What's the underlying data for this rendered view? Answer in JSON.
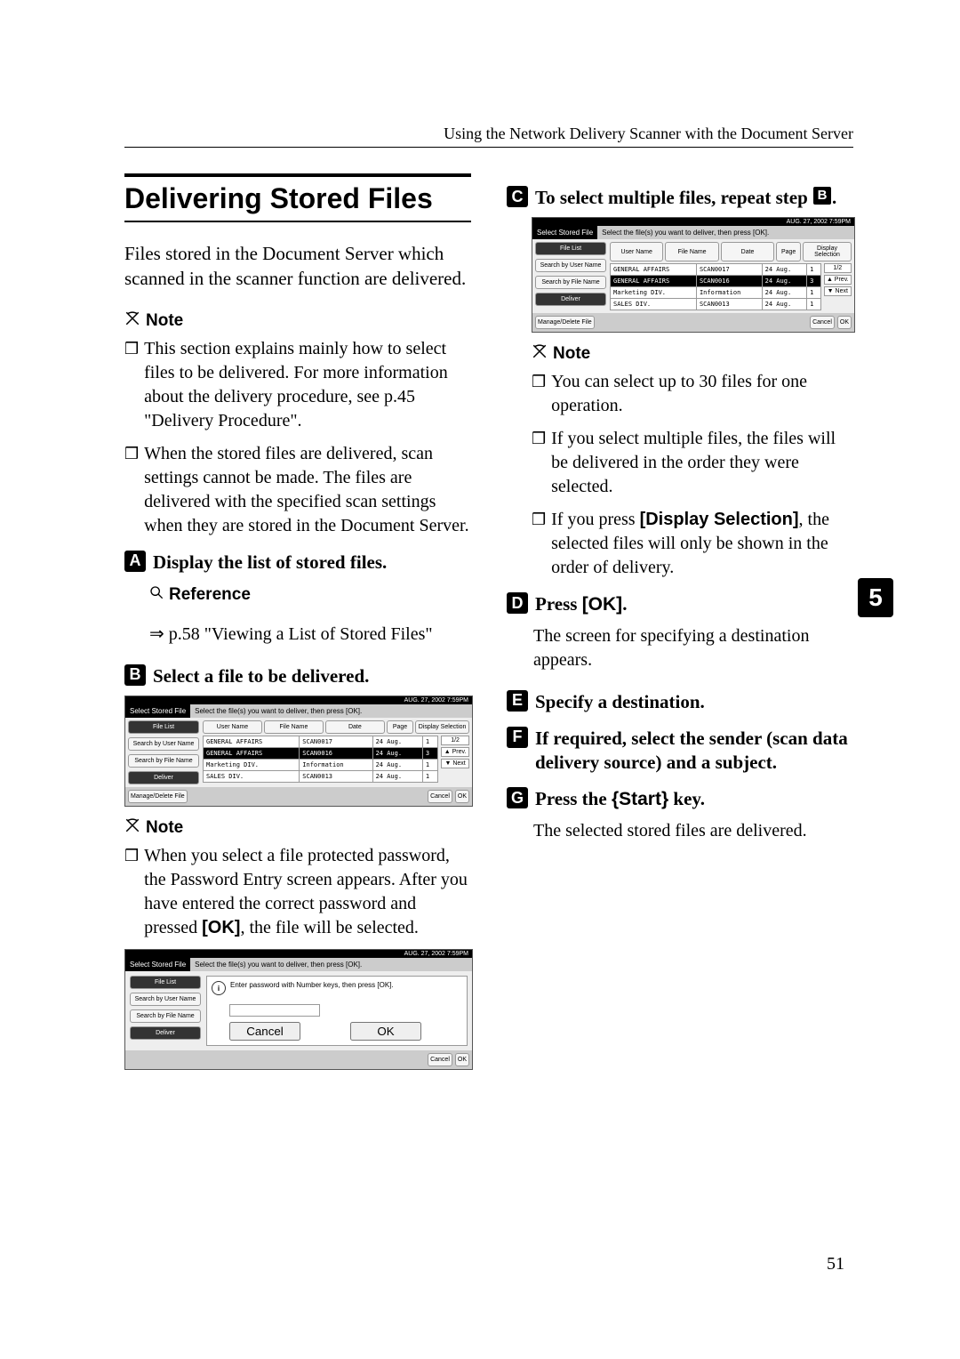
{
  "header": "Using the Network Delivery Scanner with the Document Server",
  "page_number": "51",
  "side_tab": "5",
  "h1": "Delivering Stored Files",
  "intro": "Files stored in the Document Server which scanned in the scanner function are delivered.",
  "labels": {
    "note": "Note",
    "reference": "Reference"
  },
  "col1": {
    "note1": [
      "This section explains mainly how to select files to be delivered. For more information about the delivery procedure, see p.45 \"Delivery Procedure\".",
      "When the stored files are delivered, scan settings cannot be made. The files are delivered with the specified scan settings when they are stored in the Document Server."
    ],
    "step1": "Display the list of stored files.",
    "ref1": "p.58 \"Viewing a List of Stored Files\"",
    "step2": "Select a file to be delivered.",
    "note2": [
      "When you select a file protected password, the Password Entry screen appears. After you have entered the correct password and pressed [OK], the file will be selected."
    ]
  },
  "col2": {
    "step3_a": "To select multiple files, repeat step ",
    "step3_b": ".",
    "note3": [
      "You can select up to 30 files for one operation.",
      "If you select multiple files, the files will be delivered in the order they were selected.",
      "If you press [Display Selection], the selected files will only be shown in the order of delivery."
    ],
    "step4": "Press [OK].",
    "step4_body": "The screen for specifying a destination appears.",
    "step5": "Specify a destination.",
    "step6": "If required, select the sender (scan data delivery source) and a subject.",
    "step7_a": "Press the ",
    "step7_key": "{Start}",
    "step7_b": " key.",
    "step7_body": "The selected stored files are delivered."
  },
  "screenshots": {
    "timestamp": "AUG. 27, 2002  7:59PM",
    "select_title": "Select Stored File",
    "select_instr": "Select the file(s) you want to deliver, then press [OK].",
    "leftbtns": [
      "File List",
      "Search by User Name",
      "Search by File Name",
      "Deliver"
    ],
    "headers": [
      "User Name",
      "File Name",
      "Date",
      "Page",
      "Display Selection"
    ],
    "rows": [
      {
        "user": "GENERAL AFFAIRS",
        "file": "SCAN0017",
        "date": "24 Aug.",
        "page": "1"
      },
      {
        "user": "GENERAL AFFAIRS",
        "file": "SCAN0016",
        "date": "24 Aug.",
        "page": "3"
      },
      {
        "user": "Marketing DIV.",
        "file": "Information",
        "date": "24 Aug.",
        "page": "1"
      },
      {
        "user": "SALES DIV.",
        "file": "SCAN0013",
        "date": "24 Aug.",
        "page": "1"
      }
    ],
    "rows2": [
      {
        "user": "GENERAL AFFAIRS",
        "file": "SCAN0017",
        "date": "24 Aug.",
        "page": "1"
      },
      {
        "user": "GENERAL AFFAIRS",
        "file": "SCAN0016",
        "date": "24 Aug.",
        "page": "3"
      },
      {
        "user": "Marketing DIV.",
        "file": "Information",
        "date": "24 Aug.",
        "page": "1"
      },
      {
        "user": "SALES DIV.",
        "file": "SCAN0013",
        "date": "24 Aug.",
        "page": "1"
      }
    ],
    "page_indicator": "1/2",
    "arrow_prev": "▲ Prev.",
    "arrow_next": "▼ Next",
    "footer_manage": "Manage/Delete File",
    "footer_cancel": "Cancel",
    "footer_ok": "OK",
    "pw_msg": "Enter password with Number keys, then press [OK].",
    "pw_cancel": "Cancel",
    "pw_ok": "OK"
  }
}
